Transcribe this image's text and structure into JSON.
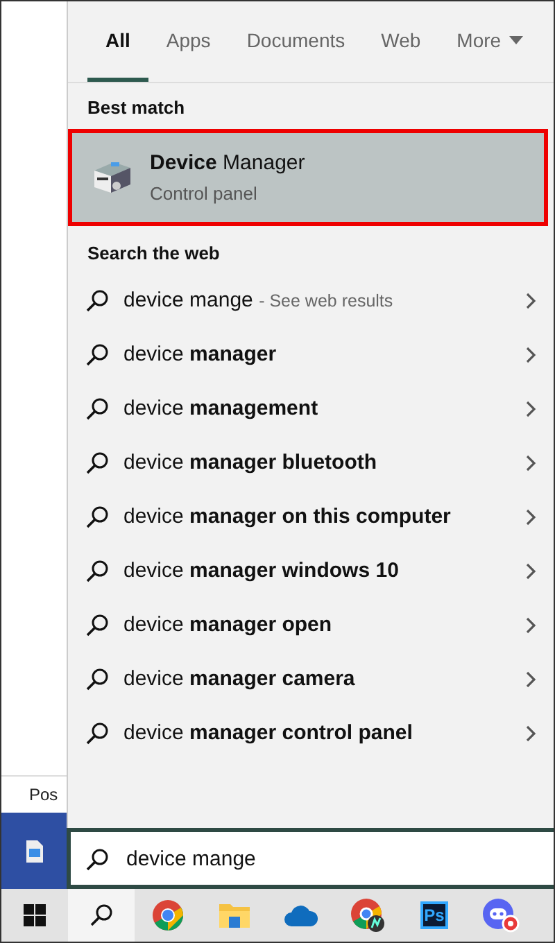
{
  "tabs": [
    {
      "label": "All",
      "selected": true
    },
    {
      "label": "Apps",
      "selected": false
    },
    {
      "label": "Documents",
      "selected": false
    },
    {
      "label": "Web",
      "selected": false
    },
    {
      "label": "More",
      "selected": false,
      "dropdown": true
    }
  ],
  "best_match": {
    "heading": "Best match",
    "title": "**Device** Manager",
    "subtitle": "Control panel",
    "selected": true
  },
  "web": {
    "heading": "Search the web",
    "suggestions": [
      {
        "text": "device mange",
        "suffix": "- See web results"
      },
      {
        "text": "device **manager**"
      },
      {
        "text": "device **management**"
      },
      {
        "text": "device **manager bluetooth**"
      },
      {
        "text": "device **manager on this computer**"
      },
      {
        "text": "device **manager windows 10**"
      },
      {
        "text": "device **manager open**"
      },
      {
        "text": "device **manager camera**"
      },
      {
        "text": "device **manager control panel**"
      }
    ]
  },
  "background": {
    "text": "Pos"
  },
  "search": {
    "value": "device mange"
  },
  "taskbar": [
    {
      "kind": "start"
    },
    {
      "kind": "search",
      "selected": true
    },
    {
      "kind": "chrome"
    },
    {
      "kind": "folder"
    },
    {
      "kind": "cloud"
    },
    {
      "kind": "chrome-badge"
    },
    {
      "kind": "ps",
      "label": "Ps"
    },
    {
      "kind": "chat"
    }
  ]
}
